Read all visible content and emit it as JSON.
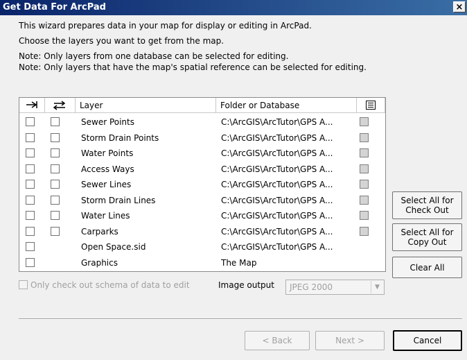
{
  "window": {
    "title": "Get Data For ArcPad",
    "close_glyph": "×"
  },
  "intro": {
    "line1": "This wizard prepares data in your map for display or editing in ArcPad.",
    "line2": "Choose the layers you want to get from the map.",
    "line3": "Note: Only layers from one database can be selected for editing.",
    "line4": "Note: Only layers that have the map's spatial reference can be selected for editing."
  },
  "grid": {
    "headers": {
      "checkout_icon": "arrow-right-icon",
      "copyout_icon": "double-arrow-icon",
      "layer": "Layer",
      "folder": "Folder or Database",
      "menu_icon": "list-icon"
    },
    "rows": [
      {
        "layer": "Sewer Points",
        "folder": "C:\\ArcGIS\\ArcTutor\\GPS A...",
        "has_checkout": true,
        "has_schema_box": true
      },
      {
        "layer": "Storm Drain Points",
        "folder": "C:\\ArcGIS\\ArcTutor\\GPS A...",
        "has_checkout": true,
        "has_schema_box": true
      },
      {
        "layer": "Water Points",
        "folder": "C:\\ArcGIS\\ArcTutor\\GPS A...",
        "has_checkout": true,
        "has_schema_box": true
      },
      {
        "layer": "Access Ways",
        "folder": "C:\\ArcGIS\\ArcTutor\\GPS A...",
        "has_checkout": true,
        "has_schema_box": true
      },
      {
        "layer": "Sewer Lines",
        "folder": "C:\\ArcGIS\\ArcTutor\\GPS A...",
        "has_checkout": true,
        "has_schema_box": true
      },
      {
        "layer": "Storm Drain Lines",
        "folder": "C:\\ArcGIS\\ArcTutor\\GPS A...",
        "has_checkout": true,
        "has_schema_box": true
      },
      {
        "layer": "Water Lines",
        "folder": "C:\\ArcGIS\\ArcTutor\\GPS A...",
        "has_checkout": true,
        "has_schema_box": true
      },
      {
        "layer": "Carparks",
        "folder": "C:\\ArcGIS\\ArcTutor\\GPS A...",
        "has_checkout": true,
        "has_schema_box": true
      },
      {
        "layer": "Open Space.sid",
        "folder": "C:\\ArcGIS\\ArcTutor\\GPS A...",
        "has_checkout": false,
        "has_schema_box": false
      },
      {
        "layer": "Graphics",
        "folder": "The Map",
        "has_checkout": false,
        "has_schema_box": false
      }
    ]
  },
  "options": {
    "schema_only_label": "Only check out schema of data to edit",
    "image_output_label": "Image output",
    "image_output_value": "JPEG 2000"
  },
  "side_buttons": {
    "select_all_checkout": "Select All for\nCheck Out",
    "select_all_copyout": "Select All for\nCopy Out",
    "clear_all": "Clear All"
  },
  "footer": {
    "back": "< Back",
    "next": "Next >",
    "cancel": "Cancel"
  }
}
